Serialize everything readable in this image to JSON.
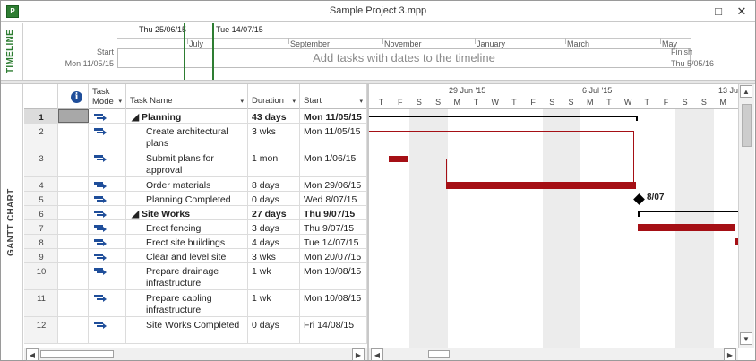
{
  "window": {
    "title": "Sample Project 3.mpp",
    "app_icon": "P",
    "restore_glyph": "□",
    "close_glyph": "✕"
  },
  "timeline": {
    "label": "TIMELINE",
    "visible_range_start": "Thu 25/06/15",
    "visible_range_end": "Tue 14/07/15",
    "scale": [
      "July",
      "September",
      "November",
      "January",
      "March",
      "May"
    ],
    "start_label": "Start",
    "start_date": "Mon 11/05/15",
    "finish_label": "Finish",
    "finish_date": "Thu 5/05/16",
    "placeholder": "Add tasks with dates to the timeline"
  },
  "gantt": {
    "label": "GANTT CHART",
    "columns": {
      "info_icon": "i",
      "task_mode_line1": "Task",
      "task_mode_line2": "Mode",
      "task_name": "Task Name",
      "duration": "Duration",
      "start": "Start",
      "dropdown_glyph": "▾"
    },
    "rows": [
      {
        "id": "1",
        "name": "◢ Planning",
        "duration": "43 days",
        "start": "Mon 11/05/15",
        "summary": true,
        "indent": 0
      },
      {
        "id": "2",
        "name": "Create architectural plans",
        "duration": "3 wks",
        "start": "Mon 11/05/15",
        "summary": false,
        "indent": 1
      },
      {
        "id": "3",
        "name": "Submit plans for approval",
        "duration": "1 mon",
        "start": "Mon 1/06/15",
        "summary": false,
        "indent": 1
      },
      {
        "id": "4",
        "name": "Order materials",
        "duration": "8 days",
        "start": "Mon 29/06/15",
        "summary": false,
        "indent": 1
      },
      {
        "id": "5",
        "name": "Planning Completed",
        "duration": "0 days",
        "start": "Wed 8/07/15",
        "summary": false,
        "indent": 1
      },
      {
        "id": "6",
        "name": "◢ Site Works",
        "duration": "27 days",
        "start": "Thu 9/07/15",
        "summary": true,
        "indent": 0
      },
      {
        "id": "7",
        "name": "Erect fencing",
        "duration": "3 days",
        "start": "Thu 9/07/15",
        "summary": false,
        "indent": 1
      },
      {
        "id": "8",
        "name": "Erect site buildings",
        "duration": "4 days",
        "start": "Tue 14/07/15",
        "summary": false,
        "indent": 1
      },
      {
        "id": "9",
        "name": "Clear and level site",
        "duration": "3 wks",
        "start": "Mon 20/07/15",
        "summary": false,
        "indent": 1
      },
      {
        "id": "10",
        "name": "Prepare drainage infrastructure",
        "duration": "1 wk",
        "start": "Mon 10/08/15",
        "summary": false,
        "indent": 1
      },
      {
        "id": "11",
        "name": "Prepare cabling infrastructure",
        "duration": "1 wk",
        "start": "Mon 10/08/15",
        "summary": false,
        "indent": 1
      },
      {
        "id": "12",
        "name": "Site Works Completed",
        "duration": "0 days",
        "start": "Fri 14/08/15",
        "summary": false,
        "indent": 1
      }
    ]
  },
  "chart": {
    "weeks": [
      "29 Jun '15",
      "6 Jul '15",
      "13 Ju"
    ],
    "days": [
      "T",
      "F",
      "S",
      "S",
      "M",
      "T",
      "W",
      "T",
      "F",
      "S",
      "S",
      "M",
      "T",
      "W",
      "T",
      "F",
      "S",
      "S",
      "M"
    ],
    "milestone_label": "8/07"
  },
  "scroll": {
    "up": "▲",
    "down": "▼",
    "left": "◀",
    "right": "▶"
  }
}
